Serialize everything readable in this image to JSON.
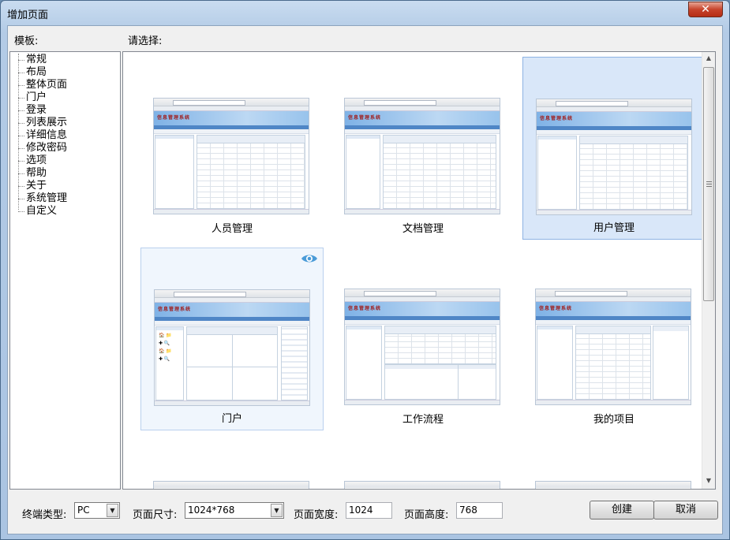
{
  "window": {
    "title": "增加页面",
    "close_glyph": "✕"
  },
  "labels": {
    "templates": "模板:",
    "choose": "请选择:"
  },
  "tree": {
    "items": [
      "常规",
      "布局",
      "整体页面",
      "门户",
      "登录",
      "列表展示",
      "详细信息",
      "修改密码",
      "选项",
      "帮助",
      "关于",
      "系统管理",
      "自定义"
    ]
  },
  "thumbnail_banner": "信息管理系统",
  "cards": [
    {
      "label": "人员管理",
      "state": "normal"
    },
    {
      "label": "文档管理",
      "state": "normal"
    },
    {
      "label": "用户管理",
      "state": "selected"
    },
    {
      "label": "门户",
      "state": "hover",
      "icon": "eye-icon"
    },
    {
      "label": "工作流程",
      "state": "normal"
    },
    {
      "label": "我的项目",
      "state": "normal"
    }
  ],
  "footer": {
    "device_type_label": "终端类型:",
    "device_type_value": "PC",
    "page_size_label": "页面尺寸:",
    "page_size_value": "1024*768",
    "page_width_label": "页面宽度:",
    "page_width_value": "1024",
    "page_height_label": "页面高度:",
    "page_height_value": "768",
    "create_button": "创建",
    "cancel_button": "取消"
  },
  "colors": {
    "selected_bg": "#d9e7f9",
    "selected_border": "#8db2e3",
    "eye_icon": "#4a9bd8",
    "close_button": "#c7432b"
  }
}
